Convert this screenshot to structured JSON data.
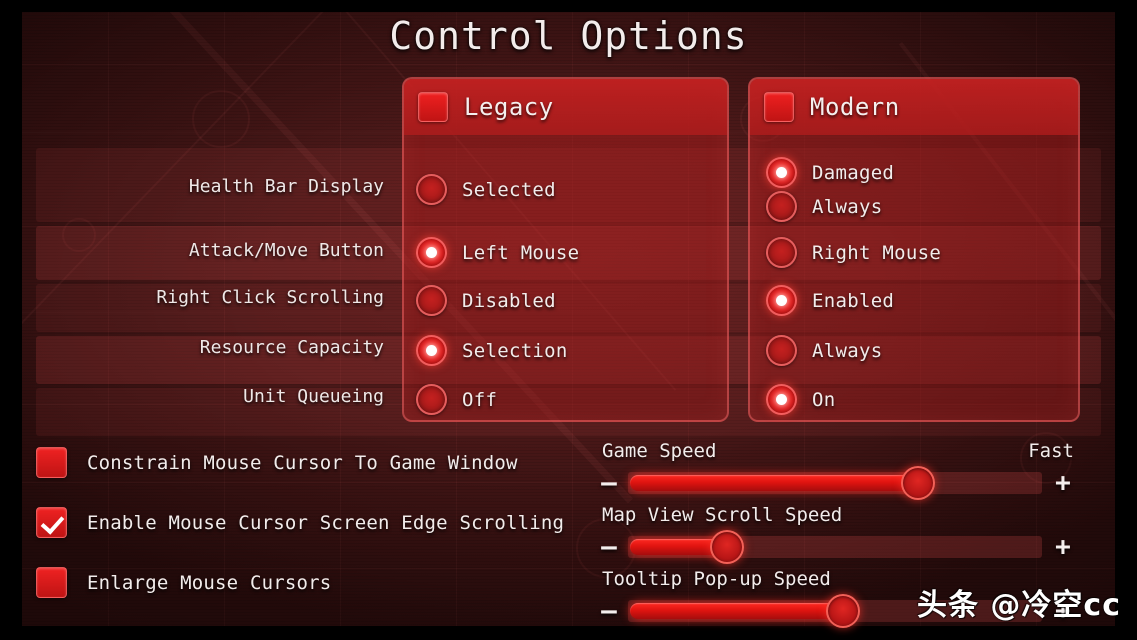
{
  "title": "Control Options",
  "columns": {
    "legacy": {
      "label": "Legacy",
      "checkbox_icon": "filled-square-icon",
      "checked": true
    },
    "modern": {
      "label": "Modern",
      "checkbox_icon": "filled-square-icon",
      "checked": true
    }
  },
  "settings_rows": [
    {
      "label": "Health Bar Display",
      "legacy": [
        {
          "label": "Selected",
          "selected": false
        }
      ],
      "modern": [
        {
          "label": "Damaged",
          "selected": true
        },
        {
          "label": "Always",
          "selected": false
        }
      ]
    },
    {
      "label": "Attack/Move Button",
      "legacy": [
        {
          "label": "Left Mouse",
          "selected": true
        }
      ],
      "modern": [
        {
          "label": "Right Mouse",
          "selected": false
        }
      ]
    },
    {
      "label": "Right Click Scrolling",
      "legacy": [
        {
          "label": "Disabled",
          "selected": false
        }
      ],
      "modern": [
        {
          "label": "Enabled",
          "selected": true
        }
      ]
    },
    {
      "label": "Resource Capacity",
      "legacy": [
        {
          "label": "Selection",
          "selected": true
        }
      ],
      "modern": [
        {
          "label": "Always",
          "selected": false
        }
      ]
    },
    {
      "label": "Unit Queueing",
      "legacy": [
        {
          "label": "Off",
          "selected": false
        }
      ],
      "modern": [
        {
          "label": "On",
          "selected": true
        }
      ]
    }
  ],
  "checkboxes": [
    {
      "label": "Constrain Mouse Cursor To Game Window",
      "checked": false
    },
    {
      "label": "Enable Mouse Cursor Screen Edge Scrolling",
      "checked": true
    },
    {
      "label": "Enlarge Mouse Cursors",
      "checked": false
    }
  ],
  "sliders": [
    {
      "title": "Game Speed",
      "right_label": "Fast",
      "value_percent": 70,
      "decrease_label": "–",
      "increase_label": "+"
    },
    {
      "title": "Map View Scroll Speed",
      "right_label": "",
      "value_percent": 24,
      "decrease_label": "–",
      "increase_label": "+"
    },
    {
      "title": "Tooltip Pop-up Speed",
      "right_label": "",
      "value_percent": 52,
      "decrease_label": "–",
      "increase_label": "+"
    }
  ],
  "watermark": "头条 @冷空cc",
  "colors": {
    "accent_red": "#e01c1c",
    "panel_border": "#ff6e6e",
    "text": "#f2eceb",
    "background_dark": "#3a1212"
  }
}
